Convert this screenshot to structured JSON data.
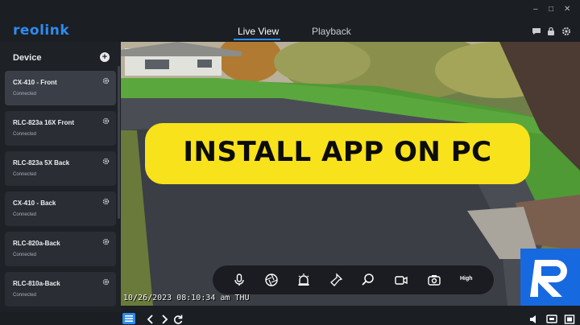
{
  "app": {
    "logo": "reolink"
  },
  "window_controls": {
    "minimize": "–",
    "maximize": "□",
    "close": "✕"
  },
  "tabs": [
    {
      "label": "Live View",
      "active": true
    },
    {
      "label": "Playback",
      "active": false
    }
  ],
  "sidebar": {
    "title": "Device",
    "add_label": "+",
    "devices": [
      {
        "name": "CX-410 - Front",
        "status": "Connected"
      },
      {
        "name": "RLC-823a 16X Front",
        "status": "Connected"
      },
      {
        "name": "RLC-823a 5X Back",
        "status": "Connected"
      },
      {
        "name": "CX-410 - Back",
        "status": "Connected"
      },
      {
        "name": "RLC-820a-Back",
        "status": "Connected"
      },
      {
        "name": "RLC-810a-Back",
        "status": "Connected"
      }
    ]
  },
  "video": {
    "timestamp": "10/26/2023 08:10:34 am THU",
    "banner": "INSTALL APP ON PC",
    "quality_label": "High"
  },
  "colors": {
    "accent": "#2d8cf0",
    "banner": "#f7e21b",
    "badge": "#1769e0"
  },
  "icons": {
    "top_right": [
      "chat-icon",
      "lock-icon",
      "gear-icon"
    ],
    "controls": [
      "microphone-icon",
      "aperture-icon",
      "siren-icon",
      "spotlight-icon",
      "zoom-icon",
      "record-icon",
      "snapshot-icon"
    ],
    "bottom_left": [
      "layout-icon",
      "prev-icon",
      "next-icon",
      "refresh-icon"
    ],
    "bottom_right": [
      "volume-icon",
      "screen-icon",
      "fullscreen-icon"
    ]
  }
}
